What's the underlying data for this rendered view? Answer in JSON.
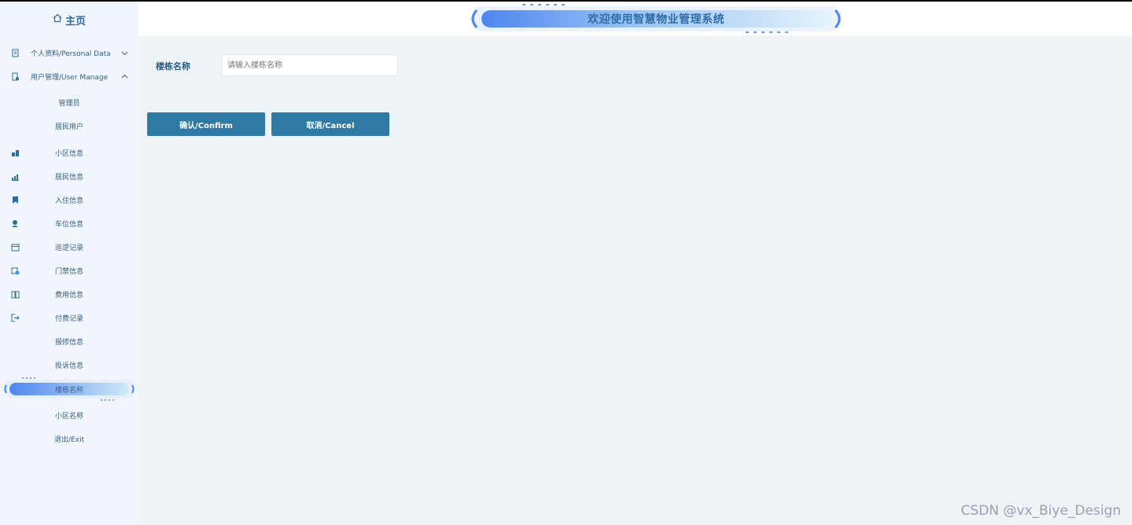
{
  "sidebar": {
    "home_label": "主页",
    "groups": [
      {
        "label": "个人资料/Personal Data",
        "icon": "document-icon",
        "expanded": false
      },
      {
        "label": "用户管理/User Manage",
        "icon": "user-file-icon",
        "expanded": true
      }
    ],
    "sub_items": [
      "管理员",
      "居民用户"
    ],
    "items": [
      {
        "label": "小区信息",
        "icon": "buildings-icon"
      },
      {
        "label": "居民信息",
        "icon": "chart-icon"
      },
      {
        "label": "入住信息",
        "icon": "bookmark-icon"
      },
      {
        "label": "车位信息",
        "icon": "person-search-icon"
      },
      {
        "label": "巡逻记录",
        "icon": "calendar-icon"
      },
      {
        "label": "门禁信息",
        "icon": "calendar-check-icon"
      },
      {
        "label": "费用信息",
        "icon": "book-icon"
      },
      {
        "label": "付费记录",
        "icon": "logout-arrow-icon"
      },
      {
        "label": "报修信息",
        "icon": ""
      },
      {
        "label": "投诉信息",
        "icon": ""
      },
      {
        "label": "楼栋名称",
        "icon": "",
        "active": true
      },
      {
        "label": "小区名称",
        "icon": ""
      },
      {
        "label": "退出/Exit",
        "icon": ""
      }
    ]
  },
  "header": {
    "title": "欢迎使用智慧物业管理系统"
  },
  "form": {
    "field_label": "楼栋名称",
    "field_placeholder": "请输入楼栋名称",
    "field_value": "",
    "confirm_label": "确认/Confirm",
    "cancel_label": "取消/Cancel"
  },
  "watermark": "CSDN @vx_Biye_Design",
  "colors": {
    "accent": "#2f7aa4",
    "sidebar_bg": "#f1f6fc",
    "main_bg": "#eef3f7",
    "pill_gradient_start": "#4f86f0",
    "pill_gradient_end": "#cfeaf8"
  }
}
